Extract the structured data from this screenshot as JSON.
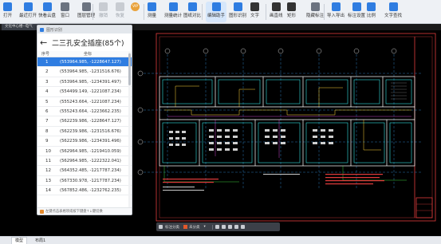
{
  "toolbar": {
    "items": [
      {
        "label": "打开",
        "icon": "folder-open-icon",
        "color": "#2f7de1"
      },
      {
        "label": "最近打开",
        "icon": "recent-file-icon",
        "color": "#2f7de1"
      },
      {
        "label": "快看云盘",
        "icon": "cloud-icon",
        "color": "#2f7de1"
      },
      {
        "label": "窗口",
        "icon": "window-icon",
        "color": "#6b7380"
      },
      {
        "label": "图层管理",
        "icon": "layers-icon",
        "color": "#6b7380"
      },
      {
        "label": "撤销",
        "icon": "undo-icon",
        "color": "#9aa0a8"
      },
      {
        "label": "恢复",
        "icon": "redo-icon",
        "color": "#9aa0a8"
      },
      {
        "label": "VIP",
        "icon": "vip-icon",
        "color": "#e9a23b"
      },
      {
        "label": "测量",
        "icon": "measure-icon",
        "color": "#2f7de1"
      },
      {
        "label": "测量统计",
        "icon": "measure-stats-icon",
        "color": "#2f7de1"
      },
      {
        "label": "图纸对比",
        "icon": "compare-icon",
        "color": "#2f7de1"
      },
      {
        "label": "编辑助手",
        "icon": "edit-assistant-icon",
        "color": "#2f7de1"
      },
      {
        "label": "图形识别",
        "icon": "recognize-icon",
        "color": "#2f7de1"
      },
      {
        "label": "文字",
        "icon": "text-icon",
        "color": "#333333"
      },
      {
        "label": "画直线",
        "icon": "line-icon",
        "color": "#333333"
      },
      {
        "label": "矩形",
        "icon": "rectangle-icon",
        "color": "#333333"
      },
      {
        "label": "隐藏标注",
        "icon": "hide-annotation-icon",
        "color": "#6b7380"
      },
      {
        "label": "导入导出",
        "icon": "import-export-icon",
        "color": "#2f7de1"
      },
      {
        "label": "标注设置",
        "icon": "annotation-settings-icon",
        "color": "#2f7de1"
      },
      {
        "label": "比例",
        "icon": "scale-icon",
        "color": "#2f7de1"
      },
      {
        "label": "文字查找",
        "icon": "text-search-icon",
        "color": "#2f7de1"
      }
    ]
  },
  "tabbar": {
    "file_tab": "文化中心楼--电气"
  },
  "panel": {
    "window_title": "图形识别",
    "back_icon": "←",
    "heading": "二三孔安全插座(85个)",
    "col_index": "序号",
    "col_coord": "坐标",
    "selected_index": 0,
    "rows": [
      {
        "idx": "1",
        "coord": "(553964.985, -1228647.127)"
      },
      {
        "idx": "2",
        "coord": "(553964.985, -1231516.676)"
      },
      {
        "idx": "3",
        "coord": "(553964.985, -1234391.497)"
      },
      {
        "idx": "4",
        "coord": "(554499.149, -1221087.234)"
      },
      {
        "idx": "5",
        "coord": "(555243.664, -1221087.234)"
      },
      {
        "idx": "6",
        "coord": "(555243.664, -1223662.235)"
      },
      {
        "idx": "7",
        "coord": "(562239.986, -1228647.127)"
      },
      {
        "idx": "8",
        "coord": "(562239.986, -1231516.676)"
      },
      {
        "idx": "9",
        "coord": "(562239.986, -1234391.496)"
      },
      {
        "idx": "10",
        "coord": "(562964.985, -1219410.059)"
      },
      {
        "idx": "11",
        "coord": "(562964.985, -1222322.041)"
      },
      {
        "idx": "12",
        "coord": "(564352.485, -1217787.234)"
      },
      {
        "idx": "13",
        "coord": "(567330.978, -1217787.234)"
      },
      {
        "idx": "14",
        "coord": "(567852.486, -1232762.235)"
      }
    ],
    "footer": "左键点击表格项或按下键盘↑↓键切换"
  },
  "floatbar": {
    "items": [
      {
        "label": "标注分类"
      },
      {
        "label": "未分类"
      }
    ]
  },
  "statusbar": {
    "tabs": [
      "模型",
      "布局1"
    ]
  },
  "colors": {
    "accent": "#2f7de1",
    "selection": "#2f7de1",
    "cad_background": "#000000"
  }
}
